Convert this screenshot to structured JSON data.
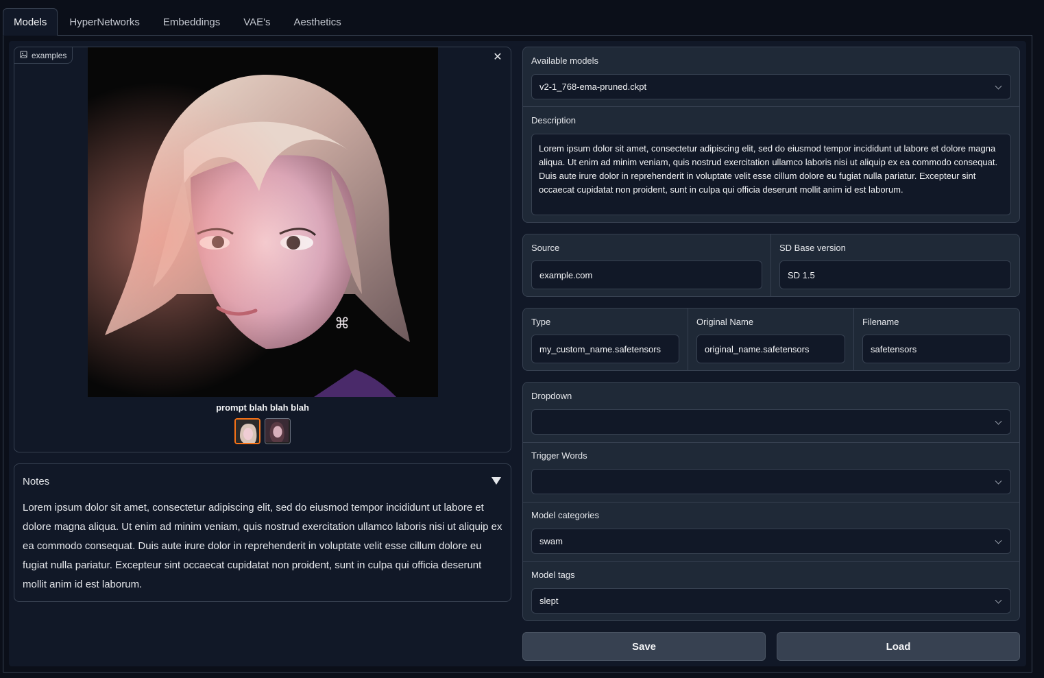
{
  "tabs": [
    {
      "label": "Models",
      "active": true
    },
    {
      "label": "HyperNetworks",
      "active": false
    },
    {
      "label": "Embeddings",
      "active": false
    },
    {
      "label": "VAE's",
      "active": false
    },
    {
      "label": "Aesthetics",
      "active": false
    }
  ],
  "gallery": {
    "label": "examples",
    "caption": "prompt blah blah blah",
    "thumbnails": 2,
    "selected_thumbnail": 1,
    "image_icon": "image-icon",
    "close_icon": "close-icon"
  },
  "notes": {
    "title": "Notes",
    "body": "Lorem ipsum dolor sit amet, consectetur adipiscing elit, sed do eiusmod tempor incididunt ut labore et dolore magna aliqua. Ut enim ad minim veniam, quis nostrud exercitation ullamco laboris nisi ut aliquip ex ea commodo consequat. Duis aute irure dolor in reprehenderit in voluptate velit esse cillum dolore eu fugiat nulla pariatur. Excepteur sint occaecat cupidatat non proident, sunt in culpa qui officia deserunt mollit anim id est laborum."
  },
  "model": {
    "available_label": "Available models",
    "available_value": "v2-1_768-ema-pruned.ckpt",
    "description_label": "Description",
    "description_value": "Lorem ipsum dolor sit amet, consectetur adipiscing elit, sed do eiusmod tempor incididunt ut labore et dolore magna aliqua. Ut enim ad minim veniam, quis nostrud exercitation ullamco laboris nisi ut aliquip ex ea commodo consequat. Duis aute irure dolor in reprehenderit in voluptate velit esse cillum dolore eu fugiat nulla pariatur. Excepteur sint occaecat cupidatat non proident, sunt in culpa qui officia deserunt mollit anim id est laborum.",
    "source_label": "Source",
    "source_value": "example.com",
    "sd_base_label": "SD Base version",
    "sd_base_value": "SD 1.5",
    "type_label": "Type",
    "type_value": "my_custom_name.safetensors",
    "original_name_label": "Original Name",
    "original_name_value": "original_name.safetensors",
    "filename_label": "Filename",
    "filename_value": "safetensors",
    "dropdown_label": "Dropdown",
    "dropdown_value": "",
    "trigger_words_label": "Trigger Words",
    "trigger_words_value": "",
    "categories_label": "Model categories",
    "categories_value": "swam",
    "tags_label": "Model tags",
    "tags_value": "slept"
  },
  "actions": {
    "save": "Save",
    "load": "Load"
  },
  "colors": {
    "accent": "#f97316",
    "background": "#0b0f19",
    "panel": "#1f2937",
    "border": "#374151"
  }
}
